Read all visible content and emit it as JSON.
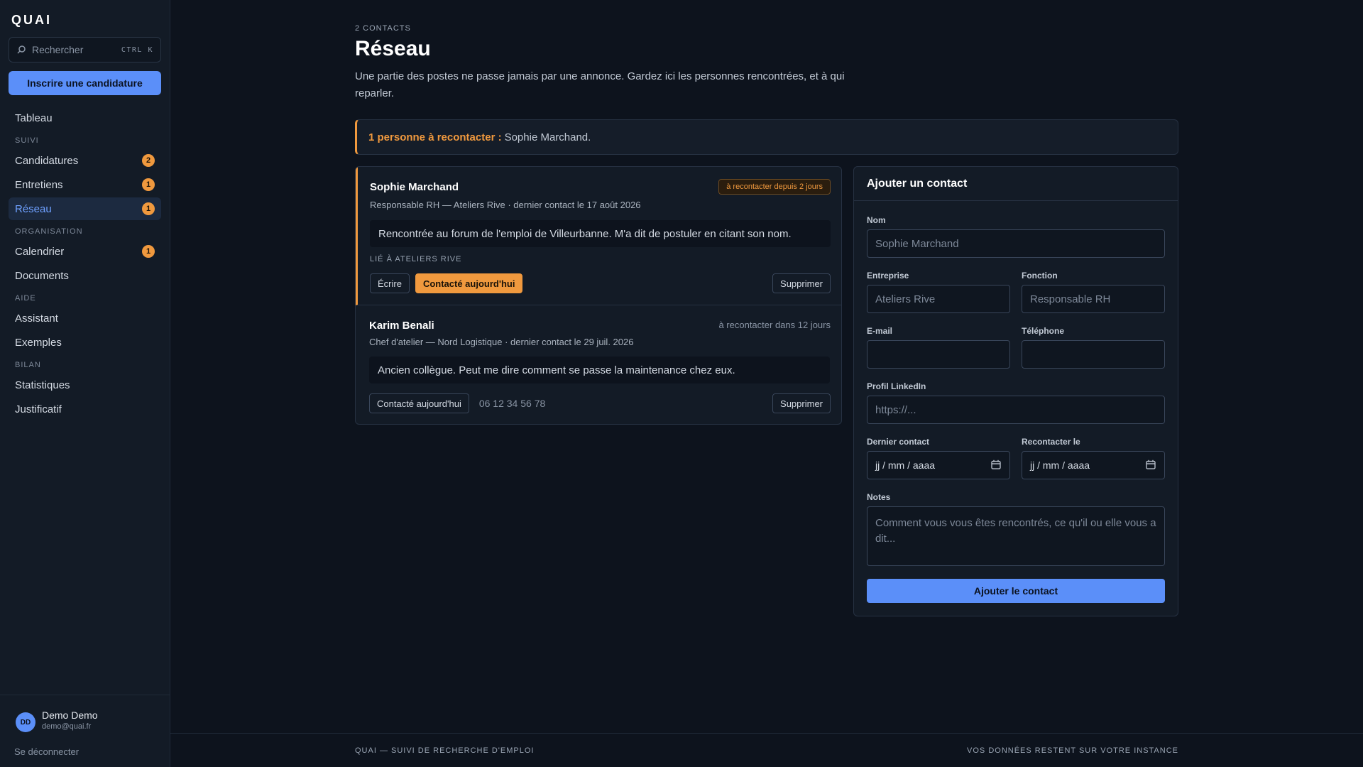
{
  "brand": "QUAI",
  "sidebar": {
    "search_placeholder": "Rechercher",
    "search_shortcut": "CTRL K",
    "cta_label": "Inscrire une candidature",
    "top_item": "Tableau",
    "sections": {
      "suivi": "SUIVI",
      "organisation": "ORGANISATION",
      "aide": "AIDE",
      "bilan": "BILAN"
    },
    "items": {
      "candidatures": {
        "label": "Candidatures",
        "badge": "2"
      },
      "entretiens": {
        "label": "Entretiens",
        "badge": "1"
      },
      "reseau": {
        "label": "Réseau",
        "badge": "1"
      },
      "calendrier": {
        "label": "Calendrier",
        "badge": "1"
      },
      "documents": {
        "label": "Documents"
      },
      "assistant": {
        "label": "Assistant"
      },
      "exemples": {
        "label": "Exemples"
      },
      "statistiques": {
        "label": "Statistiques"
      },
      "justificatif": {
        "label": "Justificatif"
      }
    },
    "user": {
      "initials": "DD",
      "name": "Demo Demo",
      "email": "demo@quai.fr"
    },
    "logout": "Se déconnecter"
  },
  "page": {
    "eyebrow": "2 CONTACTS",
    "title": "Réseau",
    "description": "Une partie des postes ne passe jamais par une annonce. Gardez ici les personnes rencontrées, et à qui reparler."
  },
  "alert": {
    "strong": "1 personne à recontacter :",
    "text": "Sophie Marchand."
  },
  "contacts": [
    {
      "name": "Sophie Marchand",
      "meta": "Responsable RH — Ateliers Rive · dernier contact le 17 août 2026",
      "status": "à recontacter depuis 2 jours",
      "note": "Rencontrée au forum de l'emploi de Villeurbanne. M'a dit de postuler en citant son nom.",
      "linked": "LIÉ À ATELIERS RIVE",
      "write_label": "Écrire",
      "contacted_label": "Contacté aujourd'hui",
      "delete_label": "Supprimer"
    },
    {
      "name": "Karim Benali",
      "meta": "Chef d'atelier — Nord Logistique · dernier contact le 29 juil. 2026",
      "status": "à recontacter dans 12 jours",
      "note": "Ancien collègue. Peut me dire comment se passe la maintenance chez eux.",
      "contacted_label": "Contacté aujourd'hui",
      "phone": "06 12 34 56 78",
      "delete_label": "Supprimer"
    }
  ],
  "form": {
    "title": "Ajouter un contact",
    "name_label": "Nom",
    "name_placeholder": "Sophie Marchand",
    "company_label": "Entreprise",
    "company_placeholder": "Ateliers Rive",
    "role_label": "Fonction",
    "role_placeholder": "Responsable RH",
    "email_label": "E-mail",
    "phone_label": "Téléphone",
    "linkedin_label": "Profil LinkedIn",
    "linkedin_placeholder": "https://...",
    "last_contact_label": "Dernier contact",
    "last_contact_value": "jj / mm / aaaa",
    "recontact_label": "Recontacter le",
    "recontact_value": "jj / mm / aaaa",
    "notes_label": "Notes",
    "notes_placeholder": "Comment vous vous êtes rencontrés, ce qu'il ou elle vous a dit...",
    "submit_label": "Ajouter le contact"
  },
  "footer": {
    "left": "QUAI — SUIVI DE RECHERCHE D'EMPLOI",
    "right": "VOS DONNÉES RESTENT SUR VOTRE INSTANCE"
  },
  "colors": {
    "accent": "#5b8ff9",
    "warning": "#f0993e",
    "background": "#0d131d"
  }
}
